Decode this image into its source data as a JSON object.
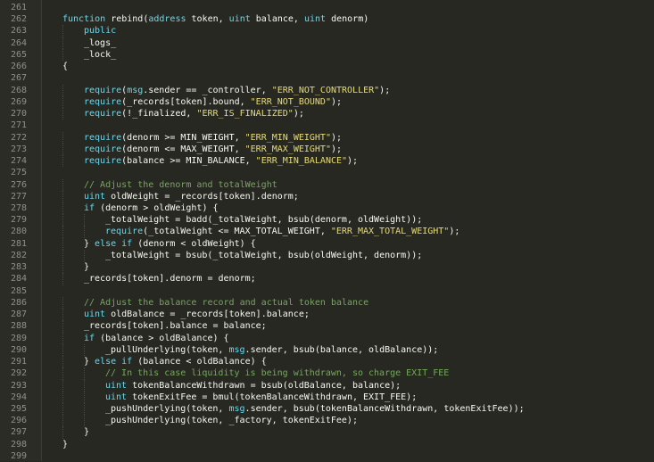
{
  "editor": {
    "lines": [
      {
        "n": "261",
        "indent": 0,
        "tokens": [
          {
            "t": "",
            "c": "id"
          }
        ]
      },
      {
        "n": "262",
        "indent": 0,
        "tokens": [
          {
            "t": "function",
            "c": "kw"
          },
          {
            "t": " rebind(",
            "c": "id"
          },
          {
            "t": "address",
            "c": "ty"
          },
          {
            "t": " token, ",
            "c": "id"
          },
          {
            "t": "uint",
            "c": "ty"
          },
          {
            "t": " balance, ",
            "c": "id"
          },
          {
            "t": "uint",
            "c": "ty"
          },
          {
            "t": " denorm)",
            "c": "id"
          }
        ]
      },
      {
        "n": "263",
        "indent": 1,
        "tokens": [
          {
            "t": "public",
            "c": "kw"
          }
        ]
      },
      {
        "n": "264",
        "indent": 1,
        "tokens": [
          {
            "t": "_logs_",
            "c": "id"
          }
        ]
      },
      {
        "n": "265",
        "indent": 1,
        "tokens": [
          {
            "t": "_lock_",
            "c": "id"
          }
        ]
      },
      {
        "n": "266",
        "indent": 0,
        "tokens": [
          {
            "t": "{",
            "c": "id"
          }
        ]
      },
      {
        "n": "267",
        "indent": 0,
        "tokens": []
      },
      {
        "n": "268",
        "indent": 1,
        "tokens": [
          {
            "t": "require",
            "c": "req"
          },
          {
            "t": "(",
            "c": "id"
          },
          {
            "t": "msg",
            "c": "kw"
          },
          {
            "t": ".sender == _controller, ",
            "c": "id"
          },
          {
            "t": "\"ERR_NOT_CONTROLLER\"",
            "c": "str"
          },
          {
            "t": ");",
            "c": "id"
          }
        ]
      },
      {
        "n": "269",
        "indent": 1,
        "tokens": [
          {
            "t": "require",
            "c": "req"
          },
          {
            "t": "(_records[token].bound, ",
            "c": "id"
          },
          {
            "t": "\"ERR_NOT_BOUND\"",
            "c": "str"
          },
          {
            "t": ");",
            "c": "id"
          }
        ]
      },
      {
        "n": "270",
        "indent": 1,
        "tokens": [
          {
            "t": "require",
            "c": "req"
          },
          {
            "t": "(!_finalized, ",
            "c": "id"
          },
          {
            "t": "\"ERR_IS_FINALIZED\"",
            "c": "str"
          },
          {
            "t": ");",
            "c": "id"
          }
        ]
      },
      {
        "n": "271",
        "indent": 0,
        "tokens": []
      },
      {
        "n": "272",
        "indent": 1,
        "tokens": [
          {
            "t": "require",
            "c": "req"
          },
          {
            "t": "(denorm >= MIN_WEIGHT, ",
            "c": "id"
          },
          {
            "t": "\"ERR_MIN_WEIGHT\"",
            "c": "str"
          },
          {
            "t": ");",
            "c": "id"
          }
        ]
      },
      {
        "n": "273",
        "indent": 1,
        "tokens": [
          {
            "t": "require",
            "c": "req"
          },
          {
            "t": "(denorm <= MAX_WEIGHT, ",
            "c": "id"
          },
          {
            "t": "\"ERR_MAX_WEIGHT\"",
            "c": "str"
          },
          {
            "t": ");",
            "c": "id"
          }
        ]
      },
      {
        "n": "274",
        "indent": 1,
        "tokens": [
          {
            "t": "require",
            "c": "req"
          },
          {
            "t": "(balance >= MIN_BALANCE, ",
            "c": "id"
          },
          {
            "t": "\"ERR_MIN_BALANCE\"",
            "c": "str"
          },
          {
            "t": ");",
            "c": "id"
          }
        ]
      },
      {
        "n": "275",
        "indent": 0,
        "tokens": []
      },
      {
        "n": "276",
        "indent": 1,
        "tokens": [
          {
            "t": "// Adjust the denorm and totalWeight",
            "c": "cm"
          }
        ]
      },
      {
        "n": "277",
        "indent": 1,
        "tokens": [
          {
            "t": "uint",
            "c": "ty"
          },
          {
            "t": " oldWeight = _records[token].denorm;",
            "c": "id"
          }
        ]
      },
      {
        "n": "278",
        "indent": 1,
        "tokens": [
          {
            "t": "if",
            "c": "ctl"
          },
          {
            "t": " (denorm > oldWeight) {",
            "c": "id"
          }
        ]
      },
      {
        "n": "279",
        "indent": 2,
        "tokens": [
          {
            "t": "_totalWeight = ",
            "c": "id"
          },
          {
            "t": "badd",
            "c": "call"
          },
          {
            "t": "(_totalWeight, ",
            "c": "id"
          },
          {
            "t": "bsub",
            "c": "call"
          },
          {
            "t": "(denorm, oldWeight));",
            "c": "id"
          }
        ]
      },
      {
        "n": "280",
        "indent": 2,
        "tokens": [
          {
            "t": "require",
            "c": "req"
          },
          {
            "t": "(_totalWeight <= MAX_TOTAL_WEIGHT, ",
            "c": "id"
          },
          {
            "t": "\"ERR_MAX_TOTAL_WEIGHT\"",
            "c": "str"
          },
          {
            "t": ");",
            "c": "id"
          }
        ]
      },
      {
        "n": "281",
        "indent": 1,
        "tokens": [
          {
            "t": "} ",
            "c": "id"
          },
          {
            "t": "else if",
            "c": "ctl"
          },
          {
            "t": " (denorm < oldWeight) {",
            "c": "id"
          }
        ]
      },
      {
        "n": "282",
        "indent": 2,
        "tokens": [
          {
            "t": "_totalWeight = ",
            "c": "id"
          },
          {
            "t": "bsub",
            "c": "call"
          },
          {
            "t": "(_totalWeight, ",
            "c": "id"
          },
          {
            "t": "bsub",
            "c": "call"
          },
          {
            "t": "(oldWeight, denorm));",
            "c": "id"
          }
        ]
      },
      {
        "n": "283",
        "indent": 1,
        "tokens": [
          {
            "t": "}",
            "c": "id"
          }
        ]
      },
      {
        "n": "284",
        "indent": 1,
        "tokens": [
          {
            "t": "_records[token].denorm = denorm;",
            "c": "id"
          }
        ]
      },
      {
        "n": "285",
        "indent": 0,
        "tokens": []
      },
      {
        "n": "286",
        "indent": 1,
        "tokens": [
          {
            "t": "// Adjust the balance record and actual token balance",
            "c": "cm"
          }
        ]
      },
      {
        "n": "287",
        "indent": 1,
        "tokens": [
          {
            "t": "uint",
            "c": "ty"
          },
          {
            "t": " oldBalance = _records[token].balance;",
            "c": "id"
          }
        ]
      },
      {
        "n": "288",
        "indent": 1,
        "tokens": [
          {
            "t": "_records[token].balance = balance;",
            "c": "id"
          }
        ]
      },
      {
        "n": "289",
        "indent": 1,
        "tokens": [
          {
            "t": "if",
            "c": "ctl"
          },
          {
            "t": " (balance > oldBalance) {",
            "c": "id"
          }
        ]
      },
      {
        "n": "290",
        "indent": 2,
        "tokens": [
          {
            "t": "_pullUnderlying(token, ",
            "c": "id"
          },
          {
            "t": "msg",
            "c": "kw"
          },
          {
            "t": ".sender, ",
            "c": "id"
          },
          {
            "t": "bsub",
            "c": "call"
          },
          {
            "t": "(balance, oldBalance));",
            "c": "id"
          }
        ]
      },
      {
        "n": "291",
        "indent": 1,
        "tokens": [
          {
            "t": "} ",
            "c": "id"
          },
          {
            "t": "else if",
            "c": "ctl"
          },
          {
            "t": " (balance < oldBalance) {",
            "c": "id"
          }
        ]
      },
      {
        "n": "292",
        "indent": 2,
        "tokens": [
          {
            "t": "// In this case liquidity is being withdrawn, so charge EXIT_FEE",
            "c": "cm"
          }
        ]
      },
      {
        "n": "293",
        "indent": 2,
        "tokens": [
          {
            "t": "uint",
            "c": "ty"
          },
          {
            "t": " tokenBalanceWithdrawn = ",
            "c": "id"
          },
          {
            "t": "bsub",
            "c": "call"
          },
          {
            "t": "(oldBalance, balance);",
            "c": "id"
          }
        ]
      },
      {
        "n": "294",
        "indent": 2,
        "tokens": [
          {
            "t": "uint",
            "c": "ty"
          },
          {
            "t": " tokenExitFee = ",
            "c": "id"
          },
          {
            "t": "bmul",
            "c": "call"
          },
          {
            "t": "(tokenBalanceWithdrawn, EXIT_FEE);",
            "c": "id"
          }
        ]
      },
      {
        "n": "295",
        "indent": 2,
        "tokens": [
          {
            "t": "_pushUnderlying(token, ",
            "c": "id"
          },
          {
            "t": "msg",
            "c": "kw"
          },
          {
            "t": ".sender, ",
            "c": "id"
          },
          {
            "t": "bsub",
            "c": "call"
          },
          {
            "t": "(tokenBalanceWithdrawn, tokenExitFee));",
            "c": "id"
          }
        ]
      },
      {
        "n": "296",
        "indent": 2,
        "tokens": [
          {
            "t": "_pushUnderlying(token, _factory, tokenExitFee);",
            "c": "id"
          }
        ]
      },
      {
        "n": "297",
        "indent": 1,
        "tokens": [
          {
            "t": "}",
            "c": "id"
          }
        ]
      },
      {
        "n": "298",
        "indent": 0,
        "tokens": [
          {
            "t": "}",
            "c": "id"
          }
        ]
      },
      {
        "n": "299",
        "indent": 0,
        "tokens": []
      }
    ]
  }
}
